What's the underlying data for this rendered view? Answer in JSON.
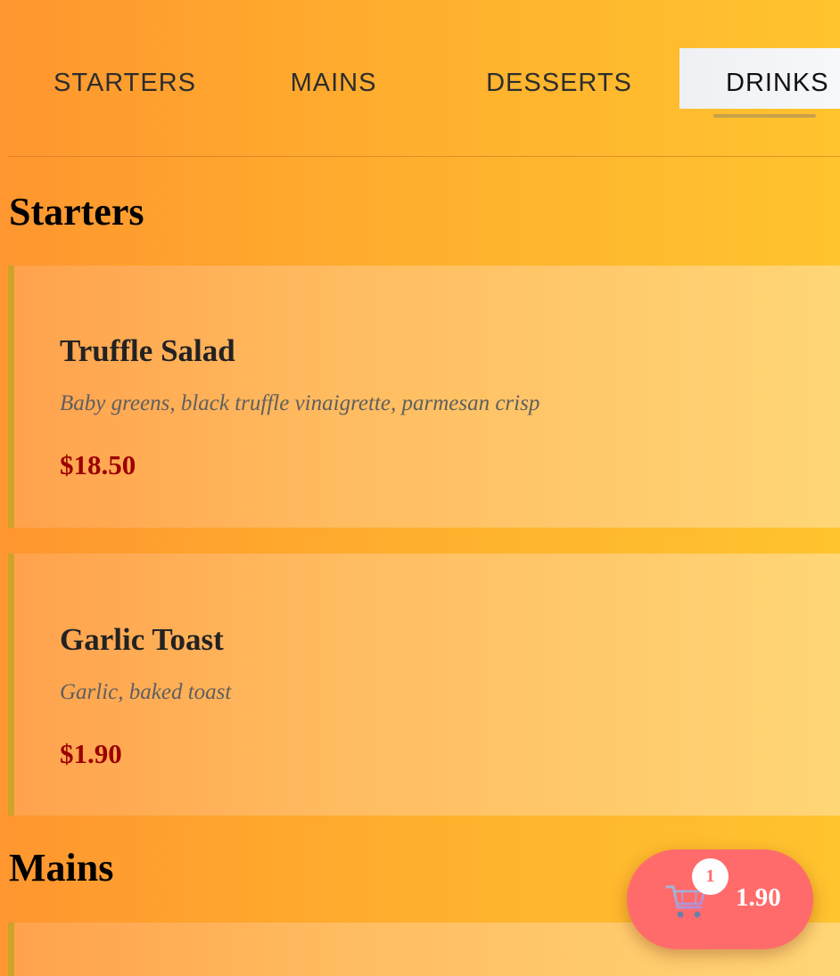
{
  "tabs": [
    {
      "label": "STARTERS",
      "active": false
    },
    {
      "label": "MAINS",
      "active": false
    },
    {
      "label": "DESSERTS",
      "active": false
    },
    {
      "label": "DRINKS",
      "active": true
    }
  ],
  "sections": [
    {
      "title": "Starters",
      "items": [
        {
          "name": "Truffle Salad",
          "description": "Baby greens, black truffle vinaigrette, parmesan crisp",
          "price": "$18.50"
        },
        {
          "name": "Garlic Toast",
          "description": "Garlic, baked toast",
          "price": "$1.90"
        }
      ]
    },
    {
      "title": "Mains",
      "items": []
    }
  ],
  "cart": {
    "count": "1",
    "total": "1.90",
    "icon": "shopping-cart-icon"
  },
  "colors": {
    "background_start": "#ff962f",
    "background_end": "#ffc42e",
    "price": "#9b0000",
    "cart_button": "#ff6b6b",
    "active_tab": "#f3f4f6"
  }
}
